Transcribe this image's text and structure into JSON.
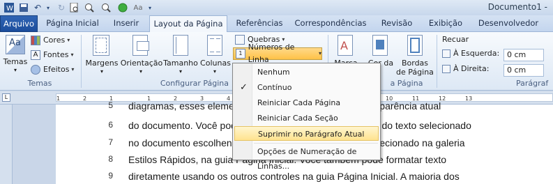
{
  "window": {
    "title": "Documento1 -"
  },
  "tabs": [
    {
      "label": "Arquivo"
    },
    {
      "label": "Página Inicial"
    },
    {
      "label": "Inserir"
    },
    {
      "label": "Layout da Página"
    },
    {
      "label": "Referências"
    },
    {
      "label": "Correspondências"
    },
    {
      "label": "Revisão"
    },
    {
      "label": "Exibição"
    },
    {
      "label": "Desenvolvedor"
    }
  ],
  "ribbon": {
    "temas": {
      "temas_label": "Temas",
      "cores_label": "Cores",
      "fontes_label": "Fontes",
      "efeitos_label": "Efeitos",
      "group_label": "Temas"
    },
    "config": {
      "margens_label": "Margens",
      "orientacao_label": "Orientação",
      "tamanho_label": "Tamanho",
      "colunas_label": "Colunas",
      "quebras_label": "Quebras",
      "numeros_label": "Números de Linha",
      "group_label": "Configurar Página"
    },
    "fundo": {
      "marca_label": "Marca",
      "cor_label": "Cor da",
      "bordas_label": "Bordas",
      "bordas_label2": "de Página",
      "group_label": "a Página"
    },
    "paragrafo": {
      "recuar_label": "Recuar",
      "esquerda_label": "À Esquerda:",
      "esquerda_value": "0 cm",
      "direita_label": "À Direita:",
      "direita_value": "0 cm",
      "group_label": "Parágraf"
    }
  },
  "ruler": {
    "numbers": [
      "1",
      "2",
      "1",
      "1",
      "2",
      "3",
      "4",
      "5",
      "6",
      "7",
      "8",
      "9",
      "10",
      "11",
      "12",
      "13"
    ]
  },
  "document": {
    "lines": [
      {
        "num": "5",
        "text": "diagramas, esses elementos também coordenam com a aparência atual"
      },
      {
        "num": "6",
        "text": "do documento. Você pode alterar facilmente a formatação do texto selecionado"
      },
      {
        "num": "7",
        "text": "no documento escolhendo uma aparência para o texto selecionado na galeria"
      },
      {
        "num": "8",
        "text": "Estilos Rápidos, na guia Página Inicial. Você também pode formatar texto"
      },
      {
        "num": "9",
        "text": "diretamente usando os outros controles na guia Página Inicial. A maioria dos"
      }
    ]
  },
  "menu": {
    "items": [
      {
        "label": "Nenhum"
      },
      {
        "label": "Contínuo",
        "checked": true
      },
      {
        "label": "Reiniciar Cada Página"
      },
      {
        "label": "Reiniciar Cada Seção"
      },
      {
        "label": "Suprimir no Parágrafo Atual",
        "highlighted": true
      },
      {
        "label": "Opções de Numeração de Linhas..."
      }
    ],
    "check_mark": "✓"
  },
  "colors": {
    "accent": "#2f64b4",
    "highlight": "#ffe38f"
  }
}
